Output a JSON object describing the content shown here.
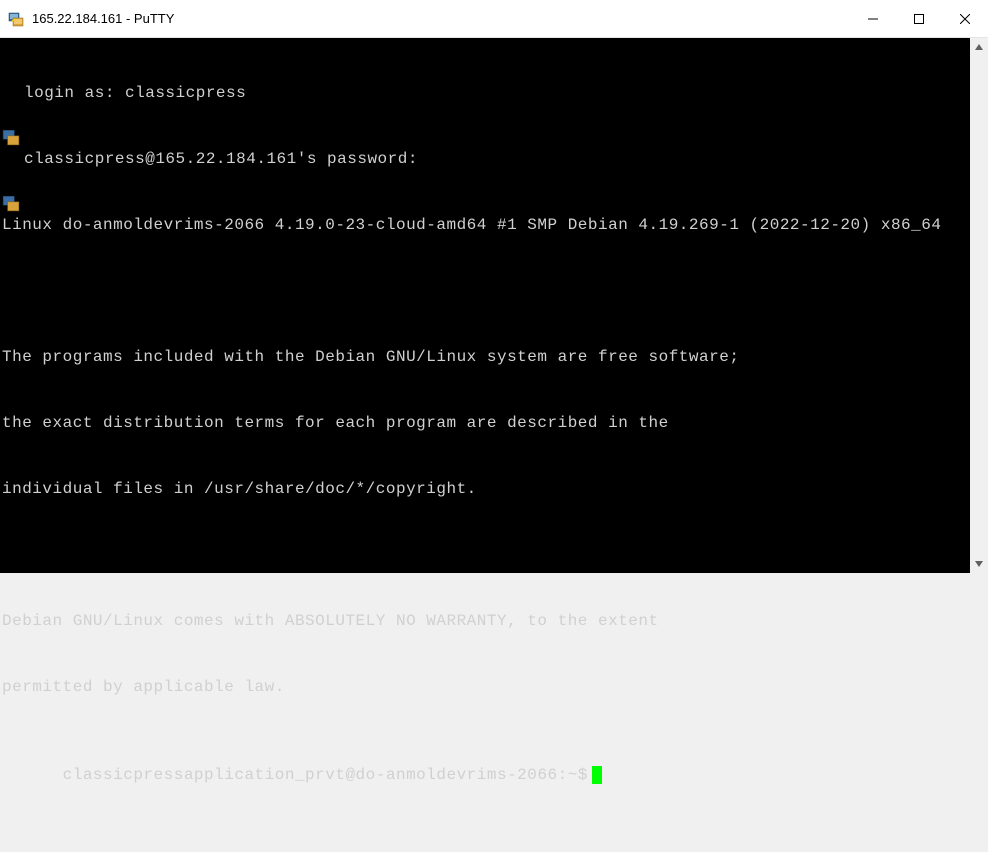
{
  "window": {
    "title": "165.22.184.161 - PuTTY"
  },
  "terminal": {
    "lines": [
      {
        "icon": true,
        "text": "login as: classicpress"
      },
      {
        "icon": true,
        "text": "classicpress@165.22.184.161's password:"
      },
      {
        "icon": false,
        "text": "Linux do-anmoldevrims-2066 4.19.0-23-cloud-amd64 #1 SMP Debian 4.19.269-1 (2022-12-20) x86_64"
      },
      {
        "icon": false,
        "text": ""
      },
      {
        "icon": false,
        "text": "The programs included with the Debian GNU/Linux system are free software;"
      },
      {
        "icon": false,
        "text": "the exact distribution terms for each program are described in the"
      },
      {
        "icon": false,
        "text": "individual files in /usr/share/doc/*/copyright."
      },
      {
        "icon": false,
        "text": ""
      },
      {
        "icon": false,
        "text": "Debian GNU/Linux comes with ABSOLUTELY NO WARRANTY, to the extent"
      },
      {
        "icon": false,
        "text": "permitted by applicable law."
      }
    ],
    "prompt": "classicpressapplication_prvt@do-anmoldevrims-2066:~$"
  }
}
